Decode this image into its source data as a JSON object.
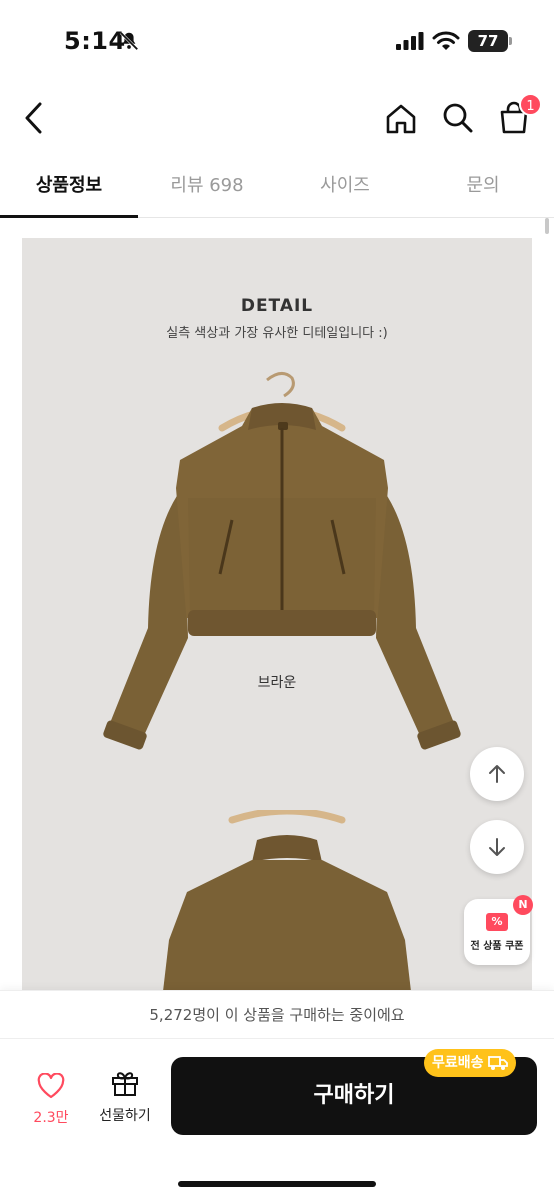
{
  "status_bar": {
    "time": "5:14",
    "battery": "77"
  },
  "nav": {
    "cart_count": "1"
  },
  "tabs": [
    {
      "label": "상품정보",
      "active": true
    },
    {
      "label": "리뷰 698",
      "active": false
    },
    {
      "label": "사이즈",
      "active": false
    },
    {
      "label": "문의",
      "active": false
    }
  ],
  "content": {
    "detail_title": "DETAIL",
    "detail_subtitle": "실측 색상과 가장 유사한 디테일입니다 :)",
    "color_label": "브라운",
    "product_color": "#7a6136"
  },
  "coupon": {
    "label": "전 상품 쿠폰",
    "badge": "N"
  },
  "buyer_strip": {
    "text": "5,272명이 이 상품을 구매하는 중이에요"
  },
  "bottom": {
    "like_count": "2.3만",
    "gift_label": "선물하기",
    "buy_label": "구매하기",
    "free_shipping": "무료배송"
  },
  "colors": {
    "accent": "#ff4a5e",
    "shipping_badge": "#ffc21a",
    "buy_button": "#111111"
  }
}
